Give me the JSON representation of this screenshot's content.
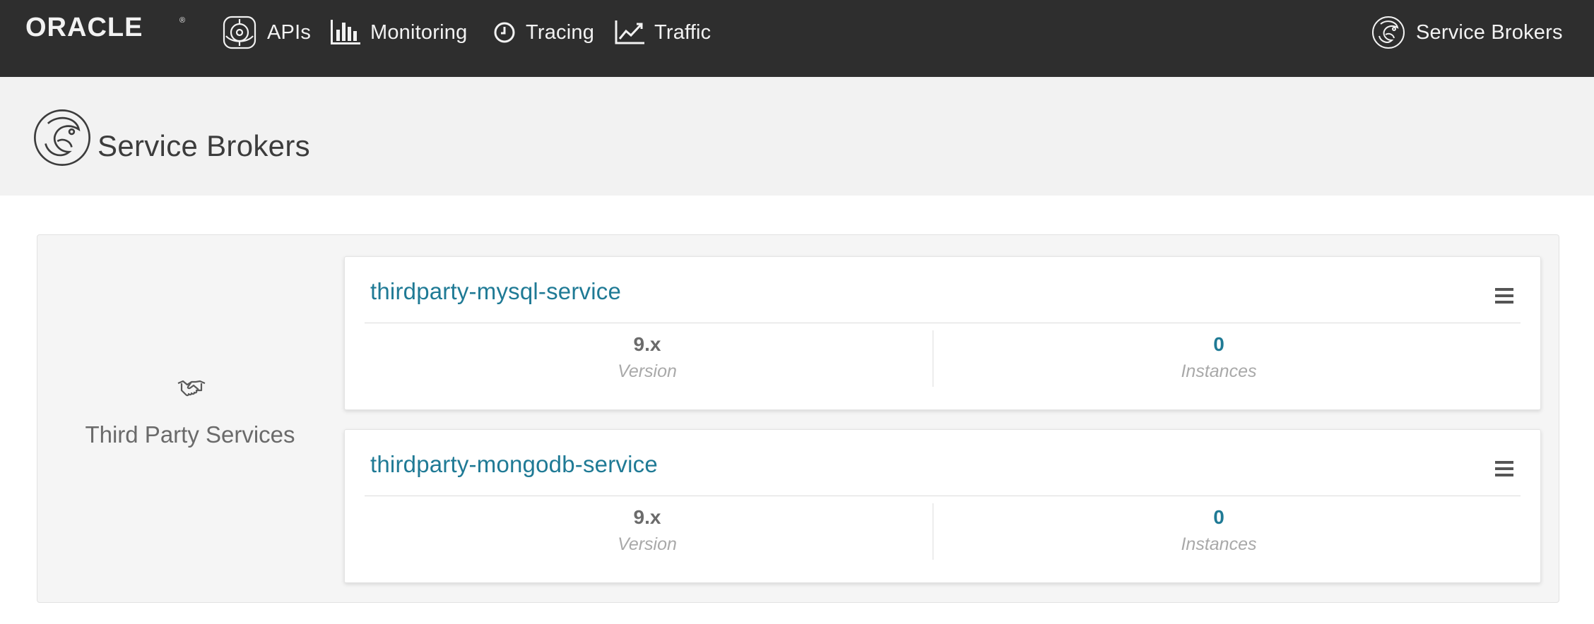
{
  "nav": {
    "brand": "ORACLE",
    "brand_mark": "®",
    "items": [
      {
        "label": "APIs",
        "icon": "api-icon"
      },
      {
        "label": "Monitoring",
        "icon": "bar-chart-icon"
      },
      {
        "label": "Tracing",
        "icon": "clock-icon"
      },
      {
        "label": "Traffic",
        "icon": "line-chart-icon"
      }
    ],
    "right": {
      "label": "Service Brokers",
      "icon": "service-broker-icon"
    }
  },
  "page": {
    "title": "Service Brokers",
    "icon": "service-broker-icon"
  },
  "group": {
    "name": "Third Party Services",
    "icon": "handshake-icon",
    "cards": [
      {
        "name": "thirdparty-mysql-service",
        "version_value": "9.x",
        "version_label": "Version",
        "instances_value": "0",
        "instances_label": "Instances"
      },
      {
        "name": "thirdparty-mongodb-service",
        "version_value": "9.x",
        "version_label": "Version",
        "instances_value": "0",
        "instances_label": "Instances"
      }
    ]
  },
  "colors": {
    "topbar": "#2e2e2e",
    "accent": "#1f7a95",
    "header_bg": "#f2f2f2",
    "panel_bg": "#f5f5f5"
  }
}
